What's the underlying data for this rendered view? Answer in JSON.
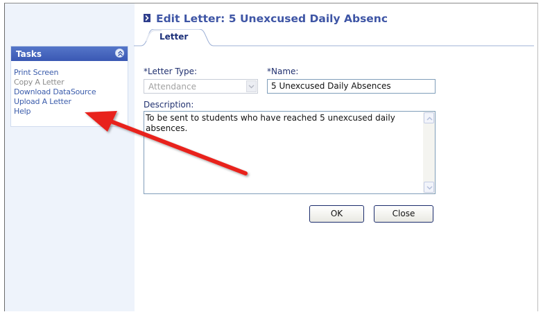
{
  "page": {
    "title": "Edit Letter: 5 Unexcused Daily Absenc"
  },
  "tabs": [
    {
      "label": "Letter",
      "active": true
    }
  ],
  "tasks": {
    "title": "Tasks",
    "items": [
      {
        "label": "Print Screen",
        "enabled": true
      },
      {
        "label": "Copy A Letter",
        "enabled": false
      },
      {
        "label": "Download DataSource",
        "enabled": true
      },
      {
        "label": "Upload A Letter",
        "enabled": true
      },
      {
        "label": "Help",
        "enabled": true
      }
    ]
  },
  "form": {
    "letter_type": {
      "label": "*Letter Type:",
      "value": "Attendance",
      "disabled": true
    },
    "name": {
      "label": "*Name:",
      "value": "5 Unexcused Daily Absences"
    },
    "description": {
      "label": "Description:",
      "value": "To be sent to students who have reached 5 unexcused daily absences."
    }
  },
  "buttons": {
    "ok_label": "OK",
    "close_label": "Close"
  },
  "icons": {
    "title": "chevron-right-icon",
    "collapse": "double-chevron-up-icon",
    "dropdown": "chevron-down-icon",
    "scroll_up": "scroll-up-arrow-icon",
    "scroll_down": "scroll-down-arrow-icon"
  },
  "colors": {
    "tasks_header": "#4766bf",
    "link": "#3b5cab",
    "title": "#3e55a5",
    "annotation_arrow": "#e8201c"
  }
}
